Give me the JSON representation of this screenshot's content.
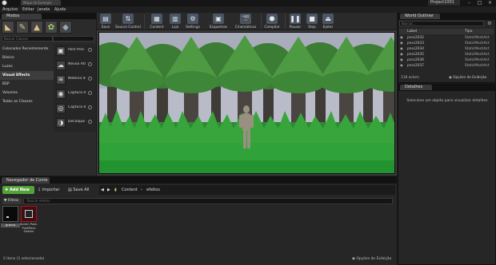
{
  "titlebar": {
    "doc_tab": "Mapa de Exemplo",
    "project": "Project1001"
  },
  "menu": [
    "Arquivo",
    "Editar",
    "Janela",
    "Ajuda"
  ],
  "modes": {
    "tab": "Modos",
    "search_placeholder": "Buscar Classes",
    "categories": [
      "Colocados Recentemente",
      "Básico",
      "Luzes",
      "Visual Effects",
      "BSP",
      "Volumes",
      "Todas as Classes"
    ],
    "active_category": "Visual Effects",
    "items": [
      "Post Proc",
      "Névoa Atmo",
      "Neblina de",
      "Captura d",
      "Captura d",
      "Decalque"
    ]
  },
  "toolbar": {
    "buttons": [
      "Save",
      "Source Control",
      "Content",
      "Lojo",
      "Settings",
      "Esquemas",
      "Cinemáticos",
      "Compilar",
      "Pausar",
      "Stop",
      "Ejetar"
    ]
  },
  "outliner": {
    "tab": "World Outliner",
    "search_placeholder": "Buscar...",
    "col_label": "Label",
    "col_type": "Tipo",
    "rows": [
      {
        "name": "pnsc2032",
        "type": "StaticMeshAct"
      },
      {
        "name": "pnsc2033",
        "type": "StaticMeshAct"
      },
      {
        "name": "pnsc2034",
        "type": "StaticMeshAct"
      },
      {
        "name": "pnsc2035",
        "type": "StaticMeshAct"
      },
      {
        "name": "pnsc2036",
        "type": "StaticMeshAct"
      },
      {
        "name": "pnsc2037",
        "type": "StaticMeshAct"
      }
    ],
    "count": "118 actors",
    "view_options": "Opções de Exibição"
  },
  "details": {
    "tab": "Detalhes",
    "message": "Selecione um objeto para visualizar detalhes"
  },
  "content_browser": {
    "tab": "Navegador de Conte",
    "add_new": "Add New",
    "import": "Importar",
    "save_all": "Save All",
    "path": [
      "Content",
      "efeitos"
    ],
    "filters": "Filtros",
    "search_placeholder": "Buscar efeitos",
    "assets": [
      {
        "name": "grama"
      },
      {
        "name": "Ilumin Post-ProEffect Sistem"
      }
    ],
    "status": "2 itens (1 selecionado)",
    "view_options": "Opções de Exibição"
  },
  "colors": {
    "add_new": "#53a33a",
    "sky": "#b9bcc8",
    "grass": "#2fa339",
    "foliage": "#3b8a38"
  }
}
